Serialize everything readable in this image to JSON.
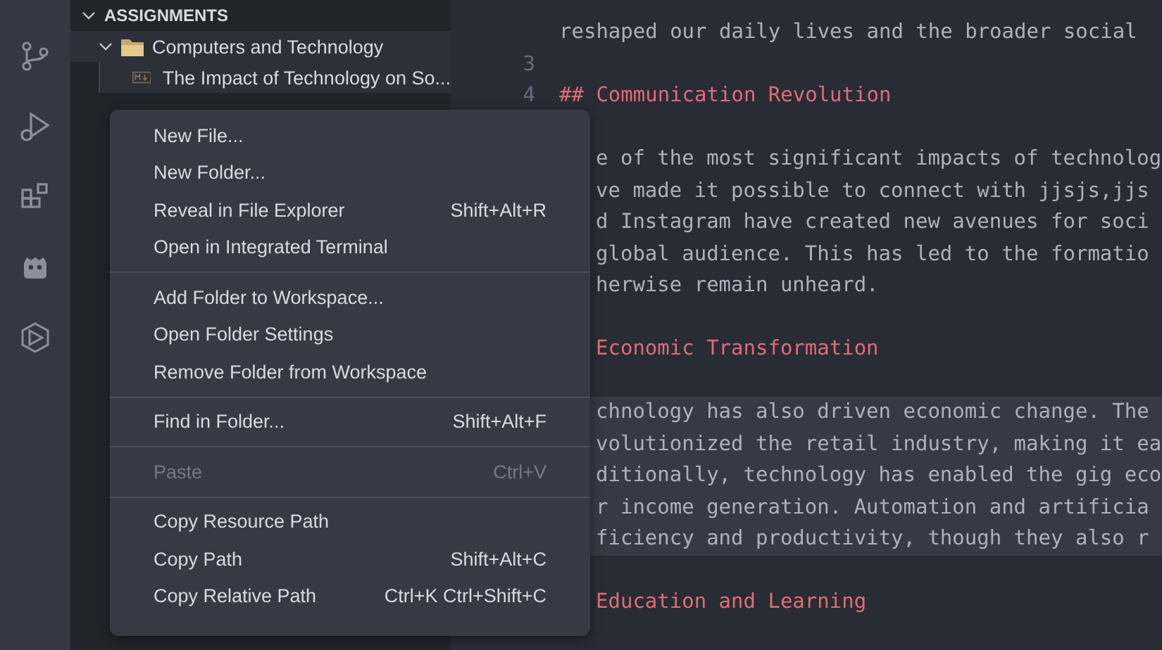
{
  "activity_bar": {
    "items": [
      {
        "kind": "source-control"
      },
      {
        "kind": "run-debug"
      },
      {
        "kind": "extensions"
      },
      {
        "kind": "robot"
      },
      {
        "kind": "hexagon"
      }
    ]
  },
  "sidebar": {
    "section": {
      "title": "ASSIGNMENTS",
      "expanded": true
    },
    "tree": [
      {
        "label": "Computers and Technology",
        "kind": "folder",
        "expanded": true,
        "children": [
          {
            "label": "The Impact of Technology on So...",
            "kind": "markdown"
          }
        ]
      }
    ]
  },
  "editor": {
    "rows": [
      {
        "kind": "text",
        "text": "reshaped our daily lives and the broader social",
        "covered": false,
        "current": false
      },
      {
        "kind": "blank",
        "line_number": "3",
        "covered": false,
        "current": false
      },
      {
        "kind": "heading",
        "text": "Communication Revolution",
        "marker": "##",
        "line_number": "4",
        "covered": false,
        "current": false
      },
      {
        "kind": "blank",
        "covered": true,
        "current": false
      },
      {
        "kind": "text",
        "text": "e of the most significant impacts of technolog",
        "covered": true,
        "current": false
      },
      {
        "kind": "text",
        "text": "ve made it possible to connect with jjsjs,jjs",
        "covered": true,
        "current": false
      },
      {
        "kind": "text",
        "text": "d Instagram have created new avenues for soci",
        "covered": true,
        "current": false
      },
      {
        "kind": "text",
        "text": "global audience. This has led to the formatio",
        "covered": true,
        "current": false
      },
      {
        "kind": "text",
        "text": "herwise remain unheard.",
        "covered": true,
        "current": false
      },
      {
        "kind": "blank",
        "covered": true,
        "current": false
      },
      {
        "kind": "heading",
        "text": "Economic Transformation",
        "covered": true,
        "current": false
      },
      {
        "kind": "blank",
        "covered": true,
        "current": false
      },
      {
        "kind": "text",
        "text": "chnology has also driven economic change. The",
        "covered": true,
        "current": true
      },
      {
        "kind": "text",
        "text": "volutionized the retail industry, making it ea",
        "covered": true,
        "current": true
      },
      {
        "kind": "text",
        "text": "ditionally, technology has enabled the gig eco",
        "covered": true,
        "current": true
      },
      {
        "kind": "text",
        "text": "r income generation. Automation and artificia",
        "covered": true,
        "current": true
      },
      {
        "kind": "text",
        "text": "ficiency and productivity, though they also r",
        "covered": true,
        "current": true
      },
      {
        "kind": "blank",
        "covered": true,
        "current": false
      },
      {
        "kind": "heading",
        "text": "Education and Learning",
        "covered": true,
        "current": false
      },
      {
        "kind": "blank",
        "covered": true,
        "current": false
      }
    ]
  },
  "context_menu": {
    "groups": [
      [
        {
          "label": "New File...",
          "disabled": false
        },
        {
          "label": "New Folder...",
          "disabled": false
        },
        {
          "label": "Reveal in File Explorer",
          "shortcut": "Shift+Alt+R",
          "disabled": false
        },
        {
          "label": "Open in Integrated Terminal",
          "disabled": false
        }
      ],
      [
        {
          "label": "Add Folder to Workspace...",
          "disabled": false
        },
        {
          "label": "Open Folder Settings",
          "disabled": false
        },
        {
          "label": "Remove Folder from Workspace",
          "disabled": false
        }
      ],
      [
        {
          "label": "Find in Folder...",
          "shortcut": "Shift+Alt+F",
          "disabled": false
        }
      ],
      [
        {
          "label": "Paste",
          "shortcut": "Ctrl+V",
          "disabled": true
        }
      ],
      [
        {
          "label": "Copy Resource Path",
          "disabled": false
        },
        {
          "label": "Copy Path",
          "shortcut": "Shift+Alt+C",
          "disabled": false
        },
        {
          "label": "Copy Relative Path",
          "shortcut": "Ctrl+K Ctrl+Shift+C",
          "disabled": false
        }
      ]
    ]
  }
}
